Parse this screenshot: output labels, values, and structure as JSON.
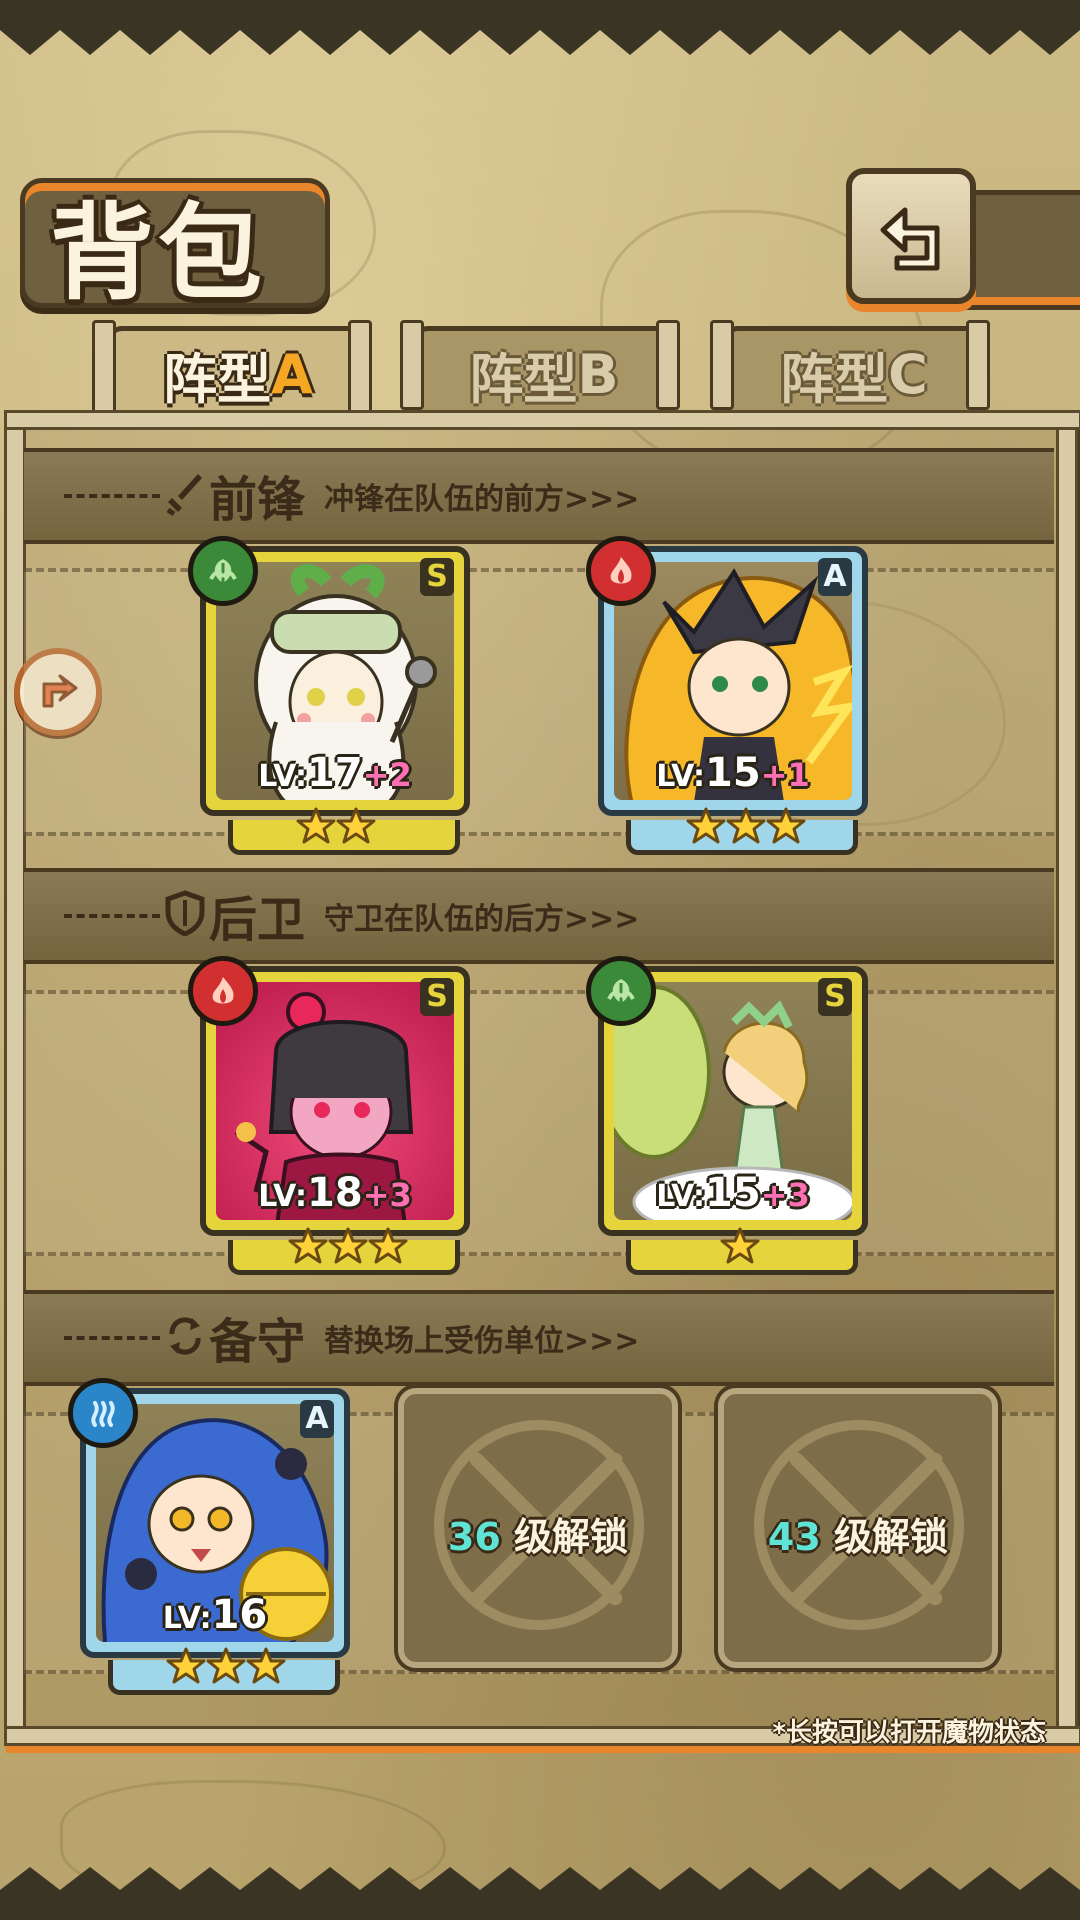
{
  "header": {
    "title": "背包",
    "back_icon": "back-return-icon"
  },
  "tabs": [
    {
      "prefix": "阵型",
      "letter": "A",
      "active": true
    },
    {
      "prefix": "阵型",
      "letter": "B",
      "active": false
    },
    {
      "prefix": "阵型",
      "letter": "C",
      "active": false
    }
  ],
  "sections": {
    "front": {
      "title": "前锋",
      "desc": "冲锋在队伍的前方>>>",
      "icon": "sword-icon"
    },
    "rear": {
      "title": "后卫",
      "desc": "守卫在队伍的后方>>>",
      "icon": "shield-icon"
    },
    "reserve": {
      "title": "备守",
      "desc": "替换场上受伤单位>>>",
      "icon": "swap-icon"
    }
  },
  "front_units": [
    {
      "rank": "S",
      "element": "leaf",
      "lv_prefix": "LV:",
      "level": "17",
      "plus": "+2",
      "stars": 2
    },
    {
      "rank": "A",
      "element": "fire",
      "lv_prefix": "LV:",
      "level": "15",
      "plus": "+1",
      "stars": 3
    }
  ],
  "rear_units": [
    {
      "rank": "S",
      "element": "fire",
      "lv_prefix": "LV:",
      "level": "18",
      "plus": "+3",
      "stars": 3
    },
    {
      "rank": "S",
      "element": "leaf",
      "lv_prefix": "LV:",
      "level": "15",
      "plus": "+3",
      "stars": 1
    }
  ],
  "reserve_unit": {
    "rank": "A",
    "element": "water",
    "lv_prefix": "LV:",
    "level": "16",
    "stars": 3
  },
  "locked_slots": [
    {
      "level": "36",
      "label": "级解锁"
    },
    {
      "level": "43",
      "label": "级解锁"
    }
  ],
  "hint": "*长按可以打开魔物状态",
  "colors": {
    "gold_frame": "#e6d43d",
    "blue_frame": "#9fd6ea",
    "accent_orange": "#e9862b",
    "unlock_level": "#5fe3d4",
    "level_plus": "#ff6fb3"
  }
}
